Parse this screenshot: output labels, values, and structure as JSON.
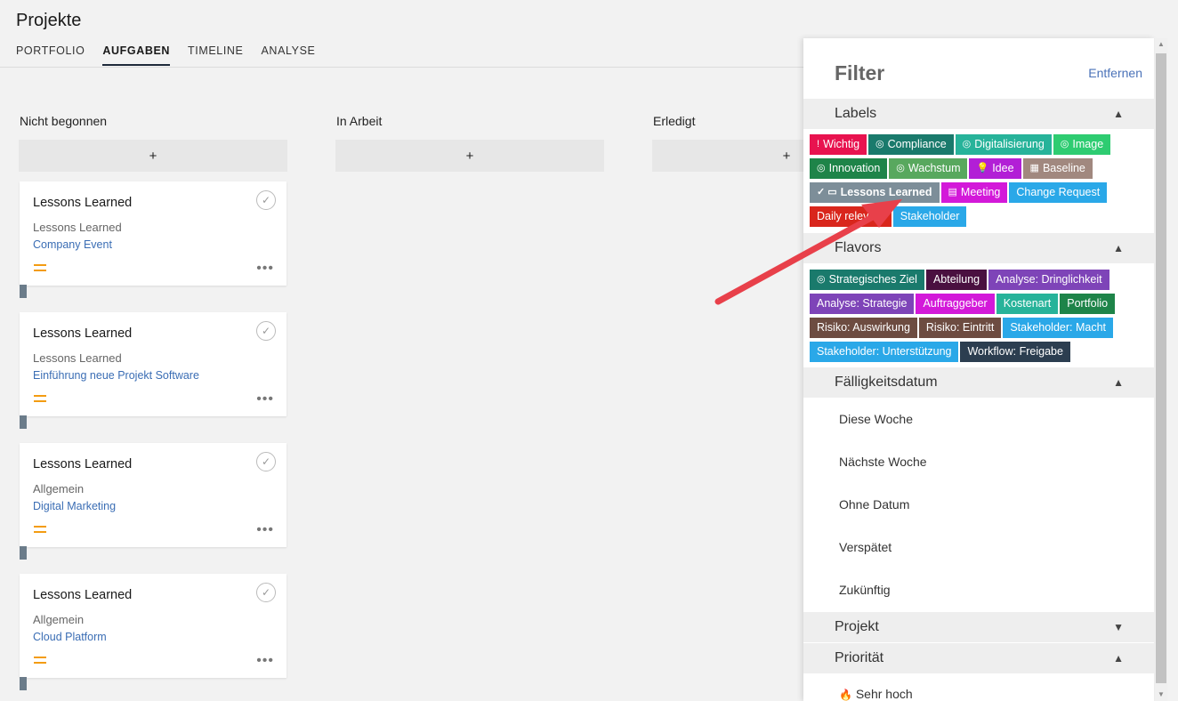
{
  "app": {
    "title": "Projekte"
  },
  "tabs": [
    {
      "label": "PORTFOLIO",
      "active": false
    },
    {
      "label": "AUFGABEN",
      "active": true
    },
    {
      "label": "TIMELINE",
      "active": false
    },
    {
      "label": "ANALYSE",
      "active": false
    }
  ],
  "board": {
    "add_label": "+",
    "columns": [
      {
        "title": "Nicht begonnen"
      },
      {
        "title": "In Arbeit"
      },
      {
        "title": "Erledigt"
      }
    ],
    "cards": [
      {
        "title": "Lessons Learned",
        "subtitle": "Lessons Learned",
        "project": "Company Event"
      },
      {
        "title": "Lessons Learned",
        "subtitle": "Lessons Learned",
        "project": "Einführung neue Projekt Software"
      },
      {
        "title": "Lessons Learned",
        "subtitle": "Allgemein",
        "project": "Digital Marketing"
      },
      {
        "title": "Lessons Learned",
        "subtitle": "Allgemein",
        "project": "Cloud Platform"
      }
    ],
    "card_more": "•••",
    "check_icon": "✓"
  },
  "filter": {
    "title": "Filter",
    "remove_label": "Entfernen",
    "sections": {
      "labels": "Labels",
      "flavors": "Flavors",
      "due": "Fälligkeitsdatum",
      "project": "Projekt",
      "priority": "Priorität"
    },
    "labels": [
      {
        "icon": "!",
        "icon_name": "exclamation-icon",
        "text": "Wichtig",
        "color": "#e8134f"
      },
      {
        "icon": "◎",
        "icon_name": "target-icon",
        "text": "Compliance",
        "color": "#1a7a6c"
      },
      {
        "icon": "◎",
        "icon_name": "target-icon",
        "text": "Digitalisierung",
        "color": "#27b39a"
      },
      {
        "icon": "◎",
        "icon_name": "target-icon",
        "text": "Image",
        "color": "#2ecc71"
      },
      {
        "icon": "◎",
        "icon_name": "target-icon",
        "text": "Innovation",
        "color": "#1e8449"
      },
      {
        "icon": "◎",
        "icon_name": "target-icon",
        "text": "Wachstum",
        "color": "#58a85e"
      },
      {
        "icon": "💡",
        "icon_name": "lightbulb-icon",
        "text": "Idee",
        "color": "#b21fd6"
      },
      {
        "icon": "▦",
        "icon_name": "calendar-icon",
        "text": "Baseline",
        "color": "#a1887f"
      },
      {
        "icon": "✓ ▭",
        "icon_name": "book-icon",
        "text": "Lessons Learned",
        "color": "#7d8e99",
        "selected": true
      },
      {
        "icon": "▤",
        "icon_name": "scroll-icon",
        "text": "Meeting",
        "color": "#d319d9"
      },
      {
        "icon": "",
        "icon_name": "",
        "text": "Change Request",
        "color": "#2aa8e8"
      },
      {
        "icon": "",
        "icon_name": "",
        "text": "Daily relevant",
        "color": "#d9261c"
      },
      {
        "icon": "",
        "icon_name": "",
        "text": "Stakeholder",
        "color": "#2aa8e8"
      }
    ],
    "flavors": [
      {
        "icon": "◎",
        "icon_name": "target-icon",
        "text": "Strategisches Ziel",
        "color": "#1a7a6c"
      },
      {
        "icon": "",
        "icon_name": "",
        "text": "Abteilung",
        "color": "#4a1040"
      },
      {
        "icon": "",
        "icon_name": "",
        "text": "Analyse: Dringlichkeit",
        "color": "#7e44b8"
      },
      {
        "icon": "",
        "icon_name": "",
        "text": "Analyse: Strategie",
        "color": "#7e44b8"
      },
      {
        "icon": "",
        "icon_name": "",
        "text": "Auftraggeber",
        "color": "#d319d9"
      },
      {
        "icon": "",
        "icon_name": "",
        "text": "Kostenart",
        "color": "#27b39a"
      },
      {
        "icon": "",
        "icon_name": "",
        "text": "Portfolio",
        "color": "#1e8449"
      },
      {
        "icon": "",
        "icon_name": "",
        "text": "Risiko: Auswirkung",
        "color": "#6d4c41"
      },
      {
        "icon": "",
        "icon_name": "",
        "text": "Risiko: Eintritt",
        "color": "#6d4c41"
      },
      {
        "icon": "",
        "icon_name": "",
        "text": "Stakeholder: Macht",
        "color": "#2aa8e8"
      },
      {
        "icon": "",
        "icon_name": "",
        "text": "Stakeholder: Unterstützung",
        "color": "#2aa8e8"
      },
      {
        "icon": "",
        "icon_name": "",
        "text": "Workflow: Freigabe",
        "color": "#2c3e50"
      }
    ],
    "due_options": [
      "Diese Woche",
      "Nächste Woche",
      "Ohne Datum",
      "Verspätet",
      "Zukünftig"
    ],
    "priority_first": {
      "icon": "🔥",
      "text": "Sehr hoch"
    }
  },
  "colors": {
    "arrow": "#e8404a",
    "priority_mark": "#f39c12",
    "link": "#3a6db4"
  }
}
